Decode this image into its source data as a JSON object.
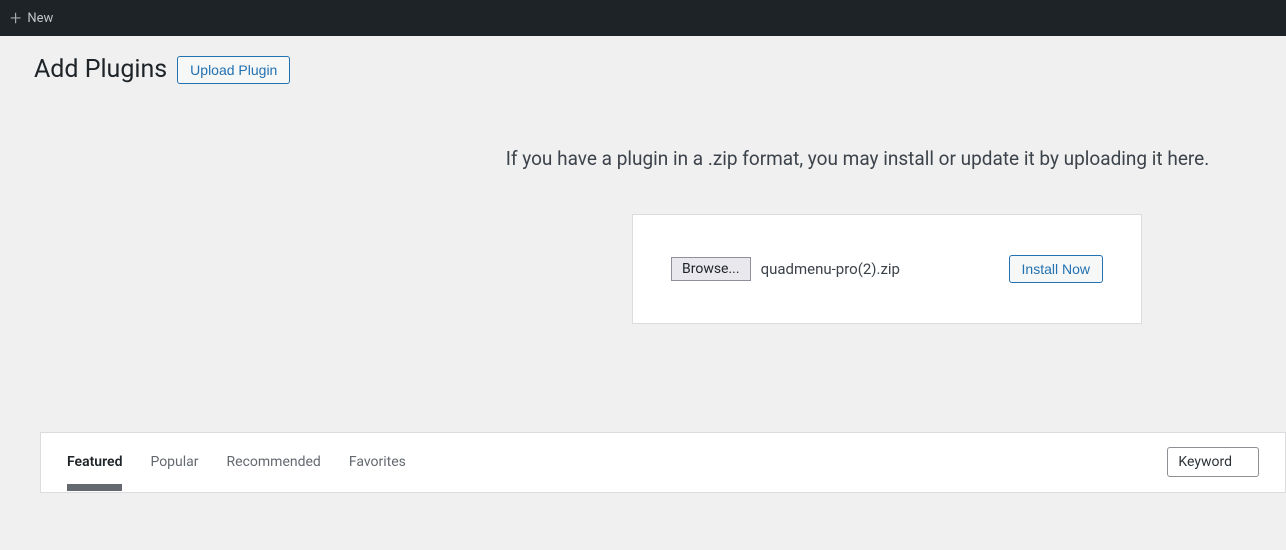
{
  "adminBar": {
    "newLabel": "New"
  },
  "header": {
    "title": "Add Plugins",
    "uploadButton": "Upload Plugin"
  },
  "uploadSection": {
    "description": "If you have a plugin in a .zip format, you may install or update it by uploading it here.",
    "browseButton": "Browse...",
    "fileName": "quadmenu-pro(2).zip",
    "installButton": "Install Now"
  },
  "filterTabs": [
    {
      "label": "Featured",
      "active": true
    },
    {
      "label": "Popular",
      "active": false
    },
    {
      "label": "Recommended",
      "active": false
    },
    {
      "label": "Favorites",
      "active": false
    }
  ],
  "search": {
    "typeSelected": "Keyword"
  }
}
